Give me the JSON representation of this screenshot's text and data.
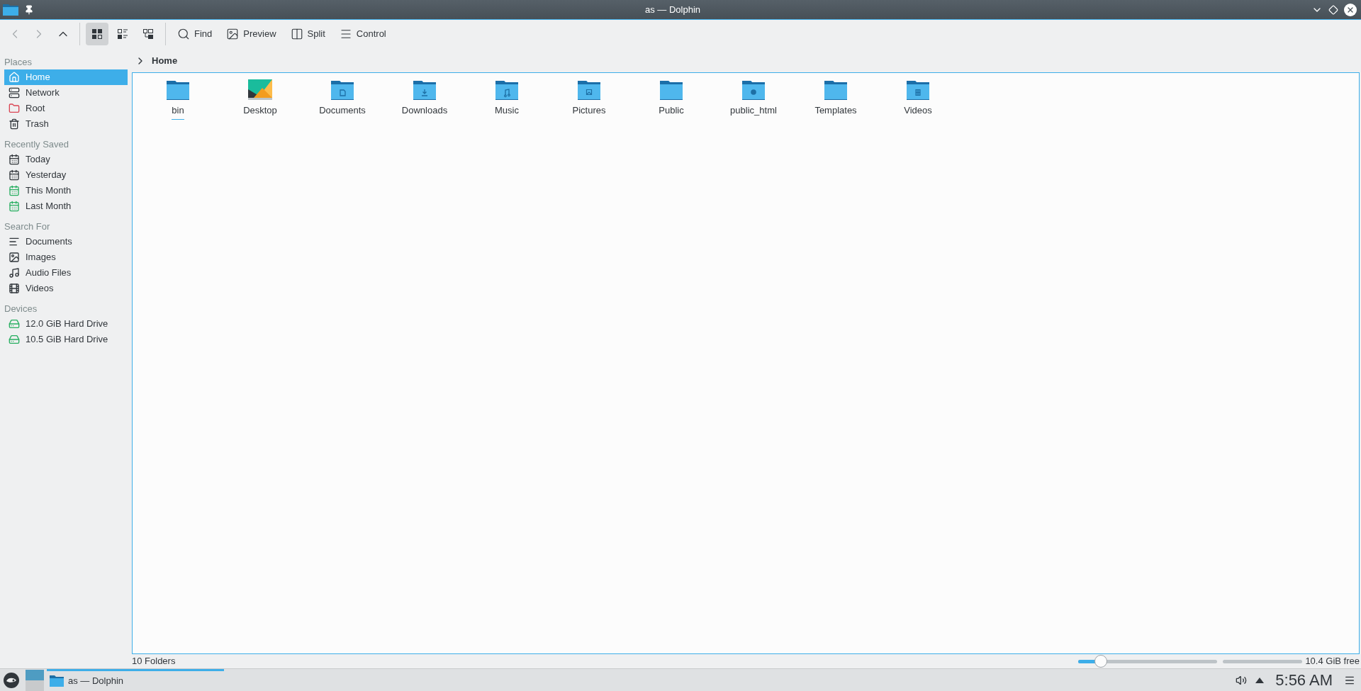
{
  "window": {
    "title": "as — Dolphin"
  },
  "toolbar": {
    "navigation": [
      {
        "kind": "back",
        "disabled": true
      },
      {
        "kind": "forward",
        "disabled": true
      },
      {
        "kind": "up",
        "disabled": false
      }
    ],
    "view_modes": [
      {
        "kind": "icons",
        "selected": true
      },
      {
        "kind": "compact",
        "selected": false
      },
      {
        "kind": "details",
        "selected": false
      }
    ],
    "actions": [
      {
        "kind": "find",
        "label": "Find"
      },
      {
        "kind": "preview",
        "label": "Preview"
      },
      {
        "kind": "split",
        "label": "Split"
      },
      {
        "kind": "control",
        "label": "Control"
      }
    ]
  },
  "sidebar": {
    "sections": [
      {
        "title": "Places",
        "items": [
          {
            "kind": "home",
            "label": "Home",
            "selected": true
          },
          {
            "kind": "network",
            "label": "Network",
            "selected": false
          },
          {
            "kind": "root",
            "label": "Root",
            "selected": false
          },
          {
            "kind": "trash",
            "label": "Trash",
            "selected": false
          }
        ]
      },
      {
        "title": "Recently Saved",
        "items": [
          {
            "kind": "calendar",
            "label": "Today",
            "selected": false
          },
          {
            "kind": "calendar",
            "label": "Yesterday",
            "selected": false
          },
          {
            "kind": "month",
            "label": "This Month",
            "selected": false
          },
          {
            "kind": "month",
            "label": "Last Month",
            "selected": false
          }
        ]
      },
      {
        "title": "Search For",
        "items": [
          {
            "kind": "documents",
            "label": "Documents",
            "selected": false
          },
          {
            "kind": "images",
            "label": "Images",
            "selected": false
          },
          {
            "kind": "audio",
            "label": "Audio Files",
            "selected": false
          },
          {
            "kind": "videos",
            "label": "Videos",
            "selected": false
          }
        ]
      },
      {
        "title": "Devices",
        "items": [
          {
            "kind": "drive",
            "label": "12.0 GiB Hard Drive",
            "selected": false
          },
          {
            "kind": "drive",
            "label": "10.5 GiB Hard Drive",
            "selected": false
          }
        ]
      }
    ]
  },
  "breadcrumb": {
    "current": "Home"
  },
  "files": [
    {
      "kind": "folder",
      "label": "bin",
      "current": true
    },
    {
      "kind": "desktop",
      "label": "Desktop",
      "current": false
    },
    {
      "kind": "documents",
      "label": "Documents",
      "current": false
    },
    {
      "kind": "downloads",
      "label": "Downloads",
      "current": false
    },
    {
      "kind": "music",
      "label": "Music",
      "current": false
    },
    {
      "kind": "pictures",
      "label": "Pictures",
      "current": false
    },
    {
      "kind": "folder",
      "label": "Public",
      "current": false
    },
    {
      "kind": "web",
      "label": "public_html",
      "current": false
    },
    {
      "kind": "folder",
      "label": "Templates",
      "current": false
    },
    {
      "kind": "videos",
      "label": "Videos",
      "current": false
    }
  ],
  "status_bar": {
    "summary": "10 Folders",
    "zoom": {
      "level": 0.16
    },
    "free_space": "10.4 GiB free"
  },
  "taskbar": {
    "tasks": [
      {
        "label": "as — Dolphin",
        "active": true
      }
    ],
    "pager": [
      {
        "selected": true
      },
      {
        "selected": false
      }
    ],
    "clock": "5:56 AM"
  }
}
